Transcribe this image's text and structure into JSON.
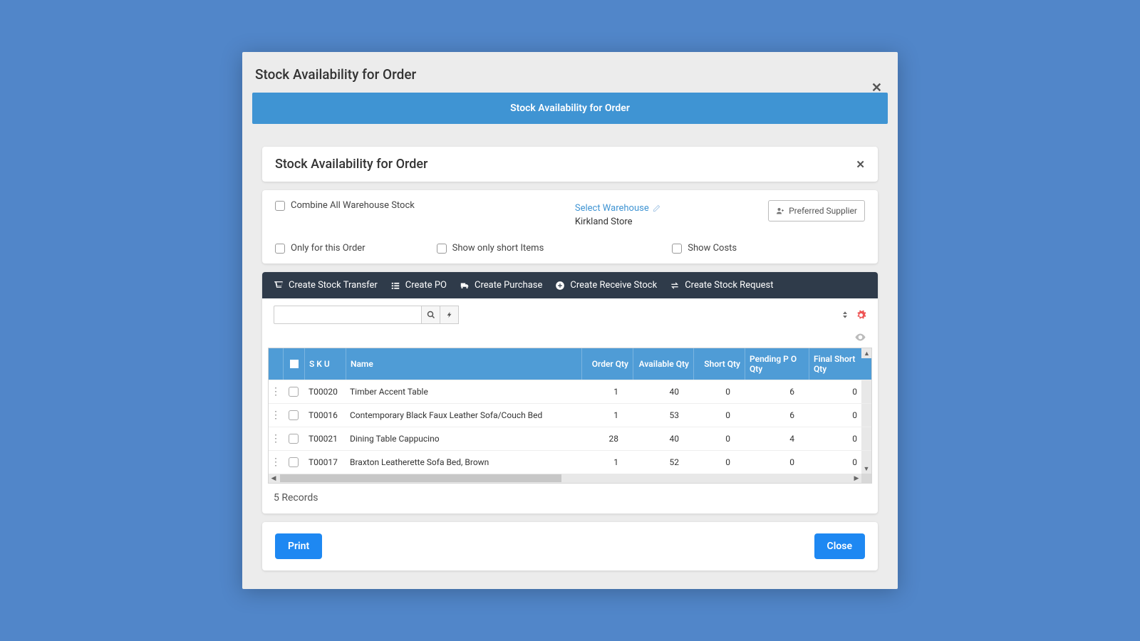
{
  "modal_title": "Stock Availability for Order",
  "banner_title": "Stock Availability for Order",
  "card_title": "Stock Availability for Order",
  "filters": {
    "combine": "Combine All Warehouse Stock",
    "only_order": "Only for this Order",
    "show_short": "Show only short Items",
    "show_costs": "Show Costs",
    "select_warehouse_link": "Select Warehouse",
    "warehouse_name": "Kirkland Store",
    "preferred_supplier": "Preferred Supplier"
  },
  "toolbar": {
    "stock_transfer": "Create Stock Transfer",
    "create_po": "Create PO",
    "create_purchase": "Create Purchase",
    "receive_stock": "Create Receive Stock",
    "stock_request": "Create Stock Request"
  },
  "grid": {
    "headers": {
      "sku": "S K U",
      "name": "Name",
      "order_qty": "Order Qty",
      "available_qty": "Available Qty",
      "short_qty": "Short Qty",
      "pending_po": "Pending P O Qty",
      "final_short": "Final Short Qty"
    },
    "rows": [
      {
        "sku": "T00020",
        "name": "Timber Accent Table",
        "order_qty": "1",
        "available_qty": "40",
        "short_qty": "0",
        "pending_po": "6",
        "final_short": "0"
      },
      {
        "sku": "T00016",
        "name": "Contemporary Black Faux Leather Sofa/Couch Bed",
        "order_qty": "1",
        "available_qty": "53",
        "short_qty": "0",
        "pending_po": "6",
        "final_short": "0"
      },
      {
        "sku": "T00021",
        "name": "Dining Table Cappucino",
        "order_qty": "28",
        "available_qty": "40",
        "short_qty": "0",
        "pending_po": "4",
        "final_short": "0"
      },
      {
        "sku": "T00017",
        "name": "Braxton Leatherette Sofa Bed, Brown",
        "order_qty": "1",
        "available_qty": "52",
        "short_qty": "0",
        "pending_po": "0",
        "final_short": "0"
      }
    ],
    "record_count": "5 Records"
  },
  "footer": {
    "print": "Print",
    "close": "Close"
  }
}
